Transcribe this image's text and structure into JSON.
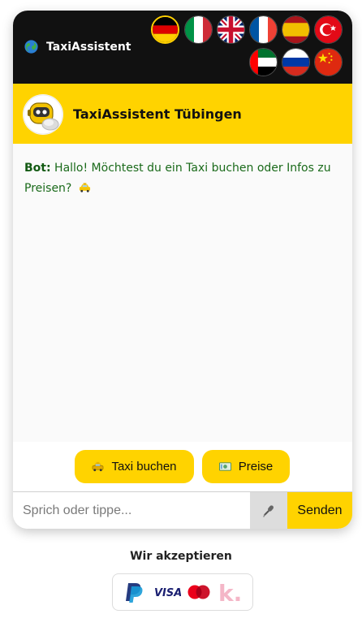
{
  "topbar": {
    "brand_name": "TaxiAssistent",
    "globe_icon": "globe-icon",
    "languages": [
      {
        "code": "de",
        "name": "Deutsch",
        "active": true
      },
      {
        "code": "it",
        "name": "Italiano",
        "active": false
      },
      {
        "code": "en",
        "name": "English",
        "active": false
      },
      {
        "code": "fr",
        "name": "Français",
        "active": false
      },
      {
        "code": "es",
        "name": "Español",
        "active": false
      },
      {
        "code": "tr",
        "name": "Türkçe",
        "active": false
      },
      {
        "code": "ar",
        "name": "العربية",
        "active": false
      },
      {
        "code": "ru",
        "name": "Русский",
        "active": false
      },
      {
        "code": "zh",
        "name": "中文",
        "active": false
      }
    ]
  },
  "header": {
    "title": "TaxiAssistent Tübingen",
    "avatar_icon": "robot-avatar-icon"
  },
  "chat": {
    "messages": [
      {
        "sender_label": "Bot:",
        "text": "Hallo! Möchtest du ein Taxi buchen oder Infos zu Preisen?",
        "emoji": "taxi-icon"
      }
    ]
  },
  "quick_replies": {
    "book_label": "Taxi buchen",
    "book_icon": "taxi-icon",
    "prices_label": "Preise",
    "prices_icon": "money-icon"
  },
  "composer": {
    "placeholder": "Sprich oder tippe...",
    "value": "",
    "mic_icon": "microphone-icon",
    "send_label": "Senden"
  },
  "payments": {
    "heading": "Wir akzeptieren",
    "methods": [
      "PayPal",
      "VISA",
      "Mastercard",
      "Klarna"
    ]
  },
  "colors": {
    "accent": "#FFD300",
    "topbar": "#111111",
    "bot_text": "#1a6a1a"
  }
}
